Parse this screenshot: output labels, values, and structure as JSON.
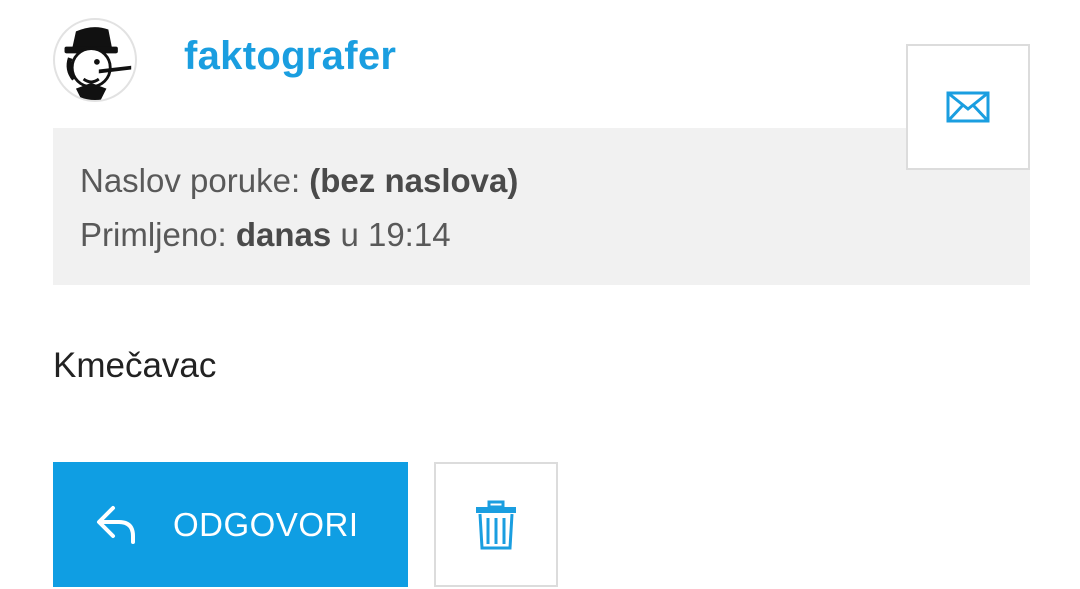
{
  "sender": {
    "avatar_icon": "pinocchio-avatar-icon",
    "username": "faktografer"
  },
  "actions": {
    "mail_icon": "envelope-icon",
    "reply_icon": "reply-arrow-icon",
    "reply_label": "ODGOVORI",
    "delete_icon": "trash-icon"
  },
  "info": {
    "subject_label": "Naslov poruke:",
    "subject_value": "(bez naslova)",
    "received_label": "Primljeno:",
    "received_day": "danas",
    "received_sep": "u",
    "received_time": "19:14"
  },
  "message": {
    "body": "Kmečavac"
  },
  "colors": {
    "accent": "#0f9ee3",
    "info_bg": "#f1f1f1"
  }
}
